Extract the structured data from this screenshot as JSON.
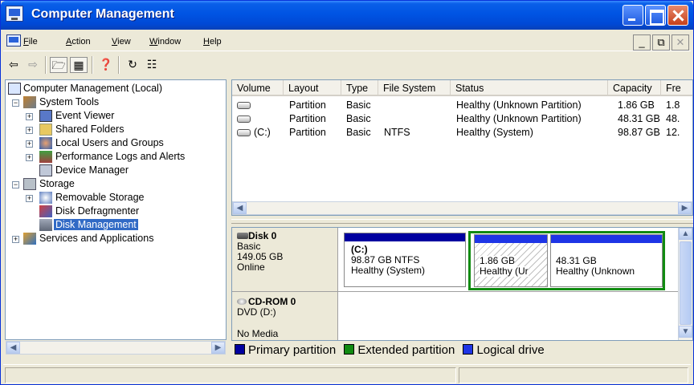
{
  "window": {
    "title": "Computer Management"
  },
  "menu": [
    "File",
    "Action",
    "View",
    "Window",
    "Help"
  ],
  "tree": {
    "root": "Computer Management (Local)",
    "system_tools": "System Tools",
    "event_viewer": "Event Viewer",
    "shared_folders": "Shared Folders",
    "local_users": "Local Users and Groups",
    "perf_logs": "Performance Logs and Alerts",
    "device_manager": "Device Manager",
    "storage": "Storage",
    "removable_storage": "Removable Storage",
    "disk_defrag": "Disk Defragmenter",
    "disk_mgmt": "Disk Management",
    "services": "Services and Applications"
  },
  "list": {
    "columns": [
      "Volume",
      "Layout",
      "Type",
      "File System",
      "Status",
      "Capacity",
      "Fre"
    ],
    "rows": [
      {
        "volume": "",
        "layout": "Partition",
        "type": "Basic",
        "fs": "",
        "status": "Healthy (Unknown Partition)",
        "capacity": "1.86 GB",
        "free": "1.8"
      },
      {
        "volume": "",
        "layout": "Partition",
        "type": "Basic",
        "fs": "",
        "status": "Healthy (Unknown Partition)",
        "capacity": "48.31 GB",
        "free": "48."
      },
      {
        "volume": "(C:)",
        "layout": "Partition",
        "type": "Basic",
        "fs": "NTFS",
        "status": "Healthy (System)",
        "capacity": "98.87 GB",
        "free": "12."
      }
    ]
  },
  "disks": {
    "disk0": {
      "name": "Disk 0",
      "type": "Basic",
      "size": "149.05 GB",
      "state": "Online"
    },
    "cdrom": {
      "name": "CD-ROM 0",
      "type": "DVD (D:)",
      "state": "No Media"
    },
    "partC": {
      "label": "(C:)",
      "size": "98.87 GB NTFS",
      "status": "Healthy (System)"
    },
    "part2": {
      "size": "1.86 GB",
      "status": "Healthy (Ur"
    },
    "part3": {
      "size": "48.31 GB",
      "status": "Healthy (Unknown"
    }
  },
  "legend": [
    "Primary partition",
    "Extended partition",
    "Logical drive"
  ],
  "colors": {
    "primary": "#0000A0",
    "extended": "#118B11",
    "logical": "#1E35E6",
    "selection": "#316AC5"
  }
}
